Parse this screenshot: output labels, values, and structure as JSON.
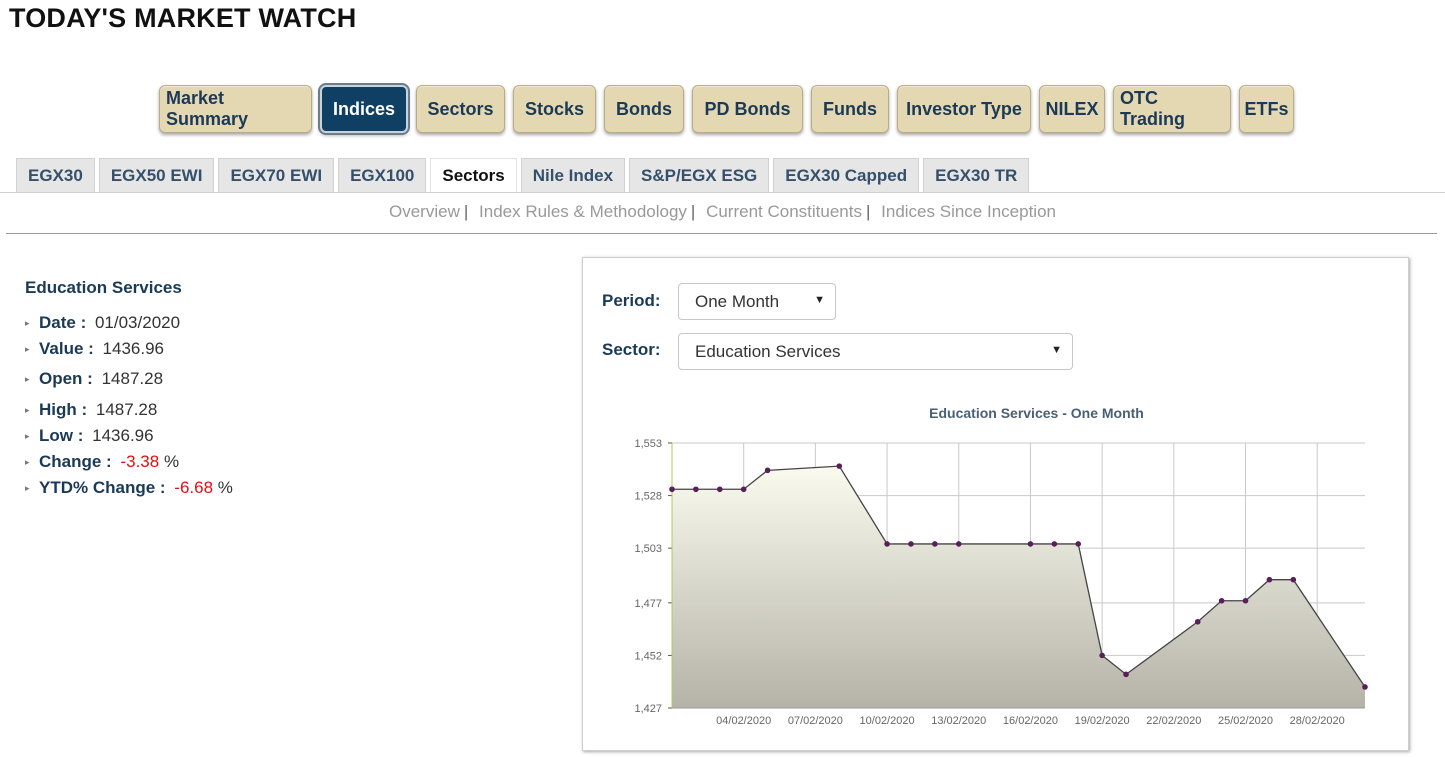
{
  "page": {
    "title": "TODAY'S MARKET WATCH"
  },
  "main_nav": [
    {
      "label": "Market Summary",
      "active": false
    },
    {
      "label": "Indices",
      "active": true
    },
    {
      "label": "Sectors",
      "active": false
    },
    {
      "label": "Stocks",
      "active": false
    },
    {
      "label": "Bonds",
      "active": false
    },
    {
      "label": "PD Bonds",
      "active": false
    },
    {
      "label": "Funds",
      "active": false
    },
    {
      "label": "Investor Type",
      "active": false
    },
    {
      "label": "NILEX",
      "active": false
    },
    {
      "label": "OTC Trading",
      "active": false
    },
    {
      "label": "ETFs",
      "active": false
    }
  ],
  "sub_tabs": [
    {
      "label": "EGX30",
      "active": false
    },
    {
      "label": "EGX50 EWI",
      "active": false
    },
    {
      "label": "EGX70 EWI",
      "active": false
    },
    {
      "label": "EGX100",
      "active": false
    },
    {
      "label": "Sectors",
      "active": true
    },
    {
      "label": "Nile Index",
      "active": false
    },
    {
      "label": "S&P/EGX ESG",
      "active": false
    },
    {
      "label": "EGX30 Capped",
      "active": false
    },
    {
      "label": "EGX30 TR",
      "active": false
    }
  ],
  "links": [
    {
      "label": "Overview"
    },
    {
      "label": "Index Rules & Methodology"
    },
    {
      "label": "Current Constituents"
    },
    {
      "label": "Indices Since Inception"
    }
  ],
  "info": {
    "title": "Education Services",
    "date_label": "Date :",
    "date": "01/03/2020",
    "value_label": "Value :",
    "value": "1436.96",
    "open_label": "Open :",
    "open": "1487.28",
    "high_label": "High :",
    "high": "1487.28",
    "low_label": "Low :",
    "low": "1436.96",
    "change_label": "Change :",
    "change": "-3.38",
    "change_unit": "%",
    "ytd_label": "YTD% Change :",
    "ytd": "-6.68",
    "ytd_unit": "%"
  },
  "controls": {
    "period_label": "Period:",
    "period_value": "One Month",
    "sector_label": "Sector:",
    "sector_value": "Education Services"
  },
  "colors": {
    "brand": "#0f3f63",
    "nav_bg": "#e4d8b2",
    "negative": "#dd1111",
    "marker": "#5a1f5a"
  },
  "chart_data": {
    "type": "area",
    "title": "Education Services - One Month",
    "xlabel": "",
    "ylabel": "",
    "ylim": [
      1427,
      1553
    ],
    "yticks": [
      "1,553",
      "1,528",
      "1,503",
      "1,477",
      "1,452",
      "1,427"
    ],
    "ytick_values": [
      1553,
      1528,
      1503,
      1477,
      1452,
      1427
    ],
    "xticks": [
      "04/02/2020",
      "07/02/2020",
      "10/02/2020",
      "13/02/2020",
      "16/02/2020",
      "19/02/2020",
      "22/02/2020",
      "25/02/2020",
      "28/02/2020"
    ],
    "x": [
      "01/02/2020",
      "02/02/2020",
      "03/02/2020",
      "04/02/2020",
      "05/02/2020",
      "06/02/2020",
      "08/02/2020",
      "09/02/2020",
      "10/02/2020",
      "11/02/2020",
      "12/02/2020",
      "13/02/2020",
      "16/02/2020",
      "17/02/2020",
      "18/02/2020",
      "19/02/2020",
      "20/02/2020",
      "23/02/2020",
      "24/02/2020",
      "25/02/2020",
      "26/02/2020",
      "27/02/2020",
      "01/03/2020"
    ],
    "series": [
      {
        "values": [
          1531,
          1531,
          1531,
          1531,
          1540,
          1542,
          1505,
          1505,
          1505,
          1505,
          1505,
          1505,
          1505,
          1452,
          1443,
          1468,
          1478,
          1478,
          1488,
          1488,
          1437
        ]
      }
    ],
    "points": [
      [
        "01/02/2020",
        1531
      ],
      [
        "02/02/2020",
        1531
      ],
      [
        "03/02/2020",
        1531
      ],
      [
        "04/02/2020",
        1531
      ],
      [
        "05/02/2020",
        1540
      ],
      [
        "08/02/2020",
        1542
      ],
      [
        "10/02/2020",
        1505
      ],
      [
        "11/02/2020",
        1505
      ],
      [
        "12/02/2020",
        1505
      ],
      [
        "13/02/2020",
        1505
      ],
      [
        "16/02/2020",
        1505
      ],
      [
        "17/02/2020",
        1505
      ],
      [
        "18/02/2020",
        1505
      ],
      [
        "19/02/2020",
        1452
      ],
      [
        "20/02/2020",
        1443
      ],
      [
        "23/02/2020",
        1468
      ],
      [
        "24/02/2020",
        1478
      ],
      [
        "25/02/2020",
        1478
      ],
      [
        "26/02/2020",
        1488
      ],
      [
        "27/02/2020",
        1488
      ],
      [
        "01/03/2020",
        1437
      ]
    ],
    "grid": true,
    "fill_gradient": [
      "#fbfaee",
      "#b5b3a8"
    ],
    "line_color": "#444444",
    "marker_color": "#5a1f5a"
  }
}
